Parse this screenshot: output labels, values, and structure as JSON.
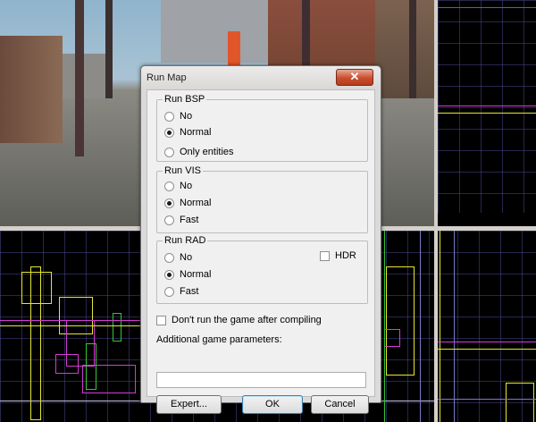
{
  "dialog": {
    "title": "Run Map",
    "close_glyph": "✕",
    "groups": {
      "bsp": {
        "title": "Run BSP",
        "options": [
          "No",
          "Normal",
          "Only entities"
        ],
        "selected": "Normal"
      },
      "vis": {
        "title": "Run VIS",
        "options": [
          "No",
          "Normal",
          "Fast"
        ],
        "selected": "Normal"
      },
      "rad": {
        "title": "Run RAD",
        "options": [
          "No",
          "Normal",
          "Fast"
        ],
        "selected": "Normal",
        "hdr_label": "HDR",
        "hdr_checked": false
      }
    },
    "dont_run_label": "Don't run the game after compiling",
    "dont_run_checked": false,
    "params_label": "Additional game parameters:",
    "params_value": "",
    "buttons": {
      "expert": "Expert...",
      "ok": "OK",
      "cancel": "Cancel"
    }
  },
  "icons": {
    "close": "close-icon"
  },
  "colors": {
    "title_close": "#c94e2e",
    "brush_yellow": "#e6e632",
    "brush_magenta": "#d23cd2",
    "brush_green": "#32c832",
    "grid_blue": "#46468c"
  }
}
